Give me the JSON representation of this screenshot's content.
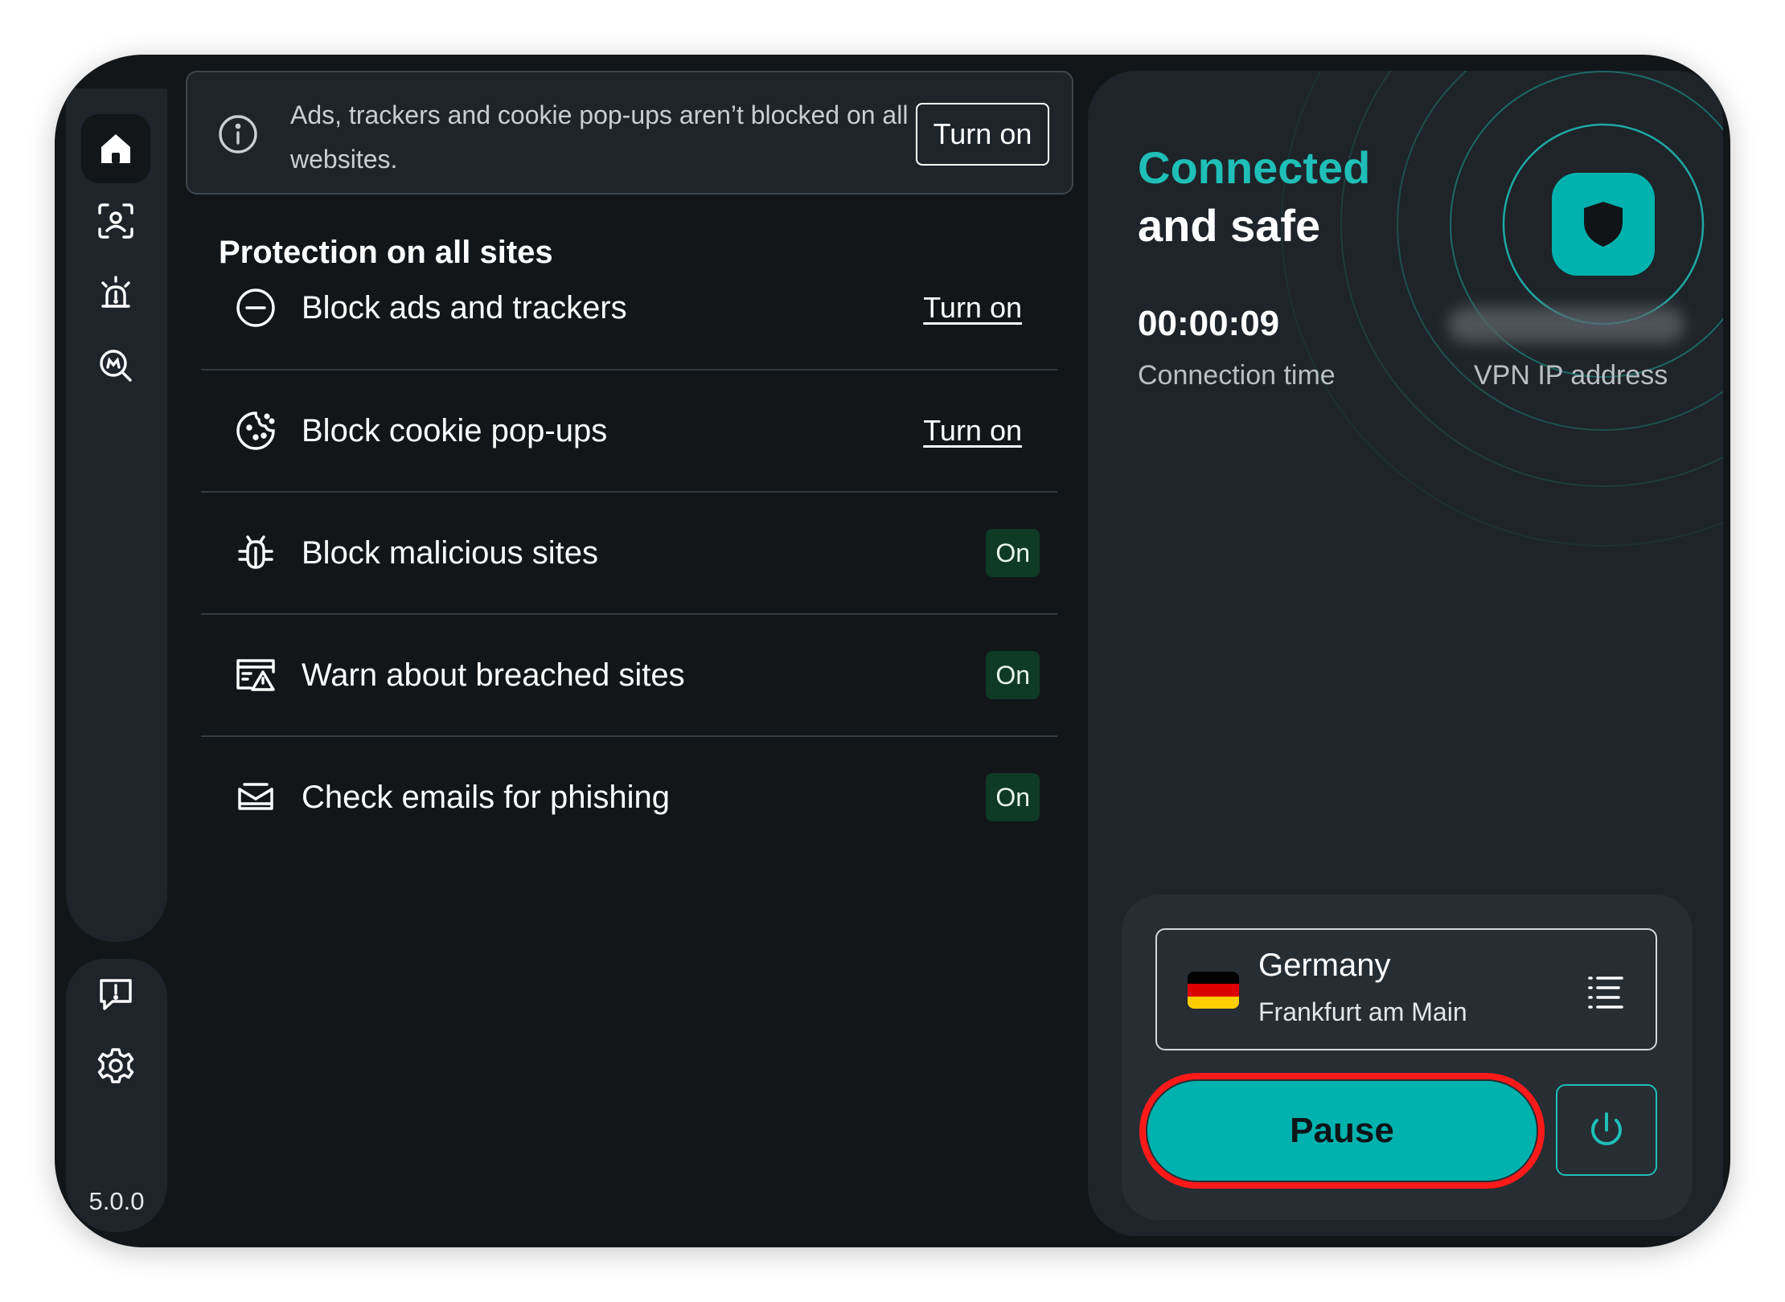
{
  "sidebar": {
    "version": "5.0.0",
    "items": [
      {
        "icon": "home-icon",
        "active": true
      },
      {
        "icon": "identity-scan-icon"
      },
      {
        "icon": "alarm-alert-icon"
      },
      {
        "icon": "tracker-search-icon"
      }
    ],
    "bottom_items": [
      {
        "icon": "feedback-icon"
      },
      {
        "icon": "settings-gear-icon"
      }
    ]
  },
  "banner": {
    "text": "Ads, trackers and cookie pop-ups aren’t blocked on all websites.",
    "button_label": "Turn on"
  },
  "protection": {
    "title": "Protection on all sites",
    "features": [
      {
        "label": "Block ads and trackers",
        "action": "Turn on",
        "icon": "block-minus-icon"
      },
      {
        "label": "Block cookie pop-ups",
        "action": "Turn on",
        "icon": "cookie-icon"
      },
      {
        "label": "Block malicious sites",
        "status": "On",
        "icon": "bug-icon"
      },
      {
        "label": "Warn about breached sites",
        "status": "On",
        "icon": "breach-warning-icon"
      },
      {
        "label": "Check emails for phishing",
        "status": "On",
        "icon": "email-check-icon"
      }
    ]
  },
  "vpn": {
    "status_line1": "Connected",
    "status_line2": "and safe",
    "connection_time": "00:00:09",
    "connection_time_label": "Connection time",
    "ip_label": "VPN IP address",
    "location": {
      "country": "Germany",
      "city": "Frankfurt am Main",
      "flag_colors": [
        "#000000",
        "#dd0000",
        "#ffce00"
      ]
    },
    "pause_label": "Pause"
  },
  "colors": {
    "accent": "#00b2ae",
    "accent_text": "#1fbfb8",
    "background": "#121619",
    "surface": "#1e2429",
    "badge_on": "#0f3a26",
    "highlight_outline": "#ff1a1a"
  }
}
